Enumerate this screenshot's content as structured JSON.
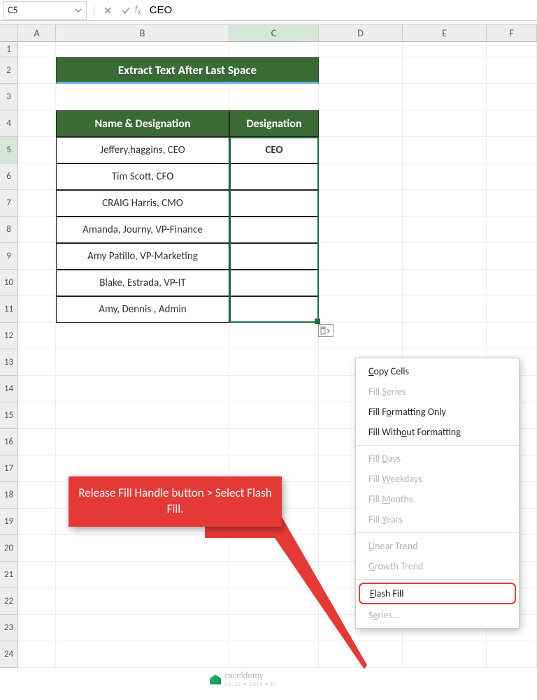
{
  "formula_bar": {
    "name_box": "C5",
    "formula_value": "CEO"
  },
  "columns": [
    "A",
    "B",
    "C",
    "D",
    "E",
    "F"
  ],
  "active_col": "C",
  "active_row": 5,
  "spreadsheet": {
    "title": "Extract Text After Last Space",
    "headers": {
      "b": "Name & Designation",
      "c": "Designation"
    },
    "rows": [
      {
        "b": "Jeffery,haggins, CEO",
        "c": "CEO"
      },
      {
        "b": "Tim Scott, CFO",
        "c": ""
      },
      {
        "b": "CRAIG Harris, CMO",
        "c": ""
      },
      {
        "b": "Amanda, Journy, VP-Finance",
        "c": ""
      },
      {
        "b": "Amy Patillo, VP-Marketing",
        "c": ""
      },
      {
        "b": "Blake, Estrada, VP-IT",
        "c": ""
      },
      {
        "b": "Amy, Dennis , Admin",
        "c": ""
      }
    ]
  },
  "context_menu": {
    "items": [
      {
        "label_pre": "",
        "ul": "C",
        "label_post": "opy Cells",
        "enabled": true
      },
      {
        "label_pre": "Fill ",
        "ul": "S",
        "label_post": "eries",
        "enabled": false
      },
      {
        "label_pre": "Fill F",
        "ul": "o",
        "label_post": "rmatting Only",
        "enabled": true
      },
      {
        "label_pre": "Fill With",
        "ul": "o",
        "label_post": "ut Formatting",
        "enabled": true
      },
      {
        "sep": true
      },
      {
        "label_pre": "Fill ",
        "ul": "D",
        "label_post": "ays",
        "enabled": false
      },
      {
        "label_pre": "Fill ",
        "ul": "W",
        "label_post": "eekdays",
        "enabled": false
      },
      {
        "label_pre": "Fill ",
        "ul": "M",
        "label_post": "onths",
        "enabled": false
      },
      {
        "label_pre": "Fill ",
        "ul": "Y",
        "label_post": "ears",
        "enabled": false
      },
      {
        "sep": true
      },
      {
        "label_pre": "",
        "ul": "L",
        "label_post": "inear Trend",
        "enabled": false
      },
      {
        "label_pre": "",
        "ul": "G",
        "label_post": "rowth Trend",
        "enabled": false
      },
      {
        "sep": true
      },
      {
        "label_pre": "",
        "ul": "F",
        "label_post": "lash Fill",
        "enabled": true,
        "highlight": true
      },
      {
        "label_pre": "S",
        "ul": "e",
        "label_post": "ries...",
        "enabled": false
      }
    ]
  },
  "callout": {
    "text": "Release Fill Handle button > Select Flash Fill."
  },
  "watermark": {
    "brand": "exceldemy",
    "tag": "EXCEL • DATA • BI"
  }
}
